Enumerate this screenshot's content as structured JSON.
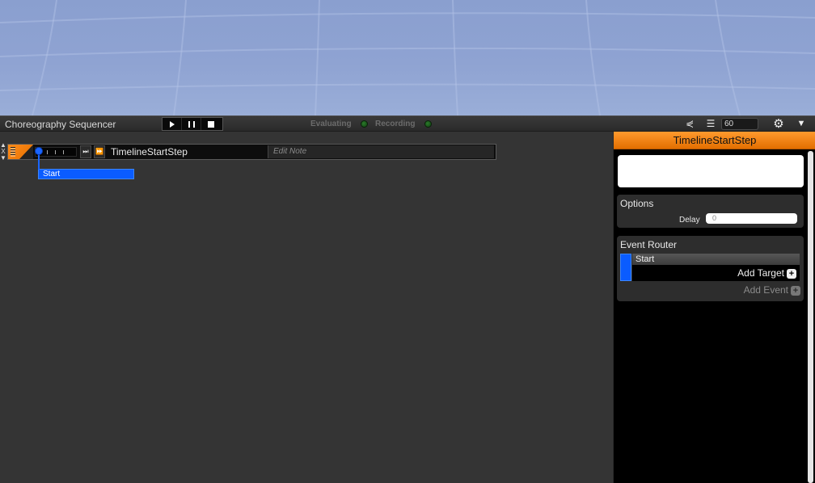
{
  "window": {
    "title": "Choreography Sequencer"
  },
  "transport": {
    "play_icon": "play-icon",
    "pause_icon": "pause-icon",
    "stop_icon": "stop-icon"
  },
  "status": {
    "evaluating_label": "Evaluating",
    "recording_label": "Recording",
    "led_color": "#1f6b1f"
  },
  "toolbar_right": {
    "branch_icon": "branch-icon",
    "list_icon": "list-icon",
    "fps_value": "60",
    "gear_icon": "gear-icon",
    "menu_icon": "chevron-down-icon"
  },
  "track": {
    "side_controls": [
      "▲",
      "X",
      "▼"
    ],
    "step_name": "TimelineStartStep",
    "note_placeholder": "Edit Note",
    "skip_end_icon": "⏭",
    "fast_forward_icon": "⏩",
    "event_chip_label": "Start",
    "accent_color": "#ff8c1a",
    "event_color": "#0a5cff"
  },
  "inspector": {
    "title": "TimelineStartStep",
    "note_text": "",
    "options": {
      "title": "Options",
      "delay_label": "Delay",
      "delay_value": "0"
    },
    "event_router": {
      "title": "Event Router",
      "event_name": "Start",
      "add_target_label": "Add Target",
      "add_event_label": "Add Event"
    }
  }
}
